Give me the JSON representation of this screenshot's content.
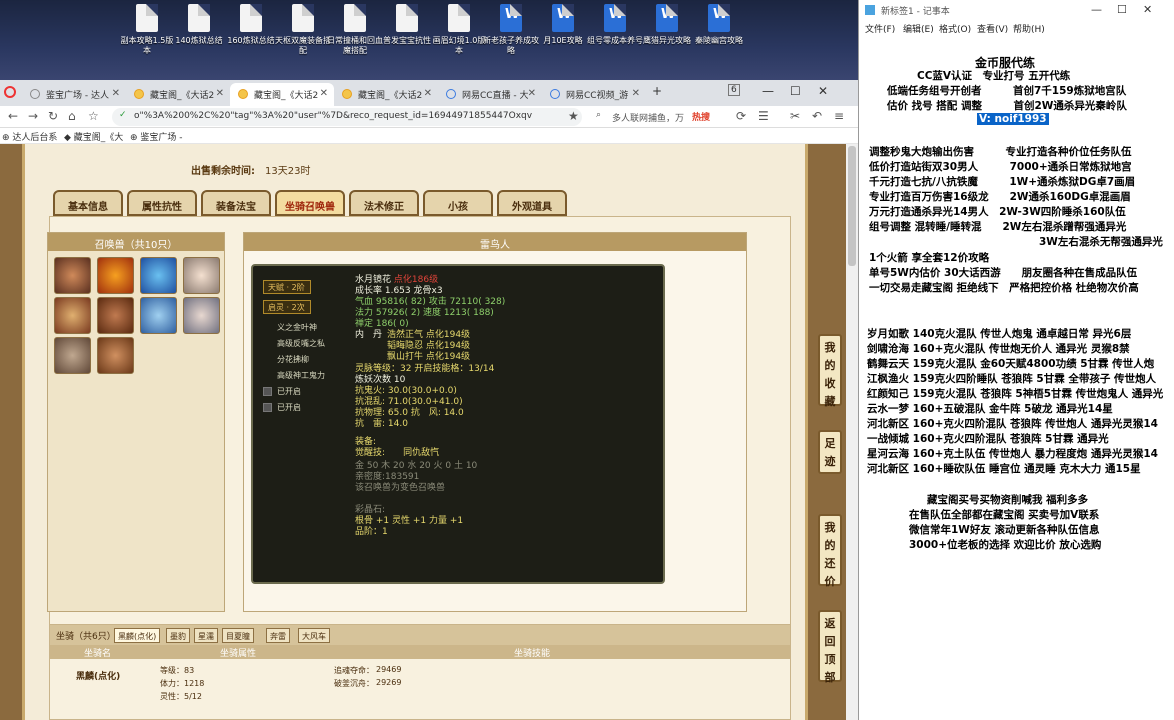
{
  "desktop": {
    "icons": [
      {
        "label": "副本攻略1.5版本",
        "type": "doc"
      },
      {
        "label": "140炼狱总结",
        "type": "doc"
      },
      {
        "label": "160炼狱总结",
        "type": "doc"
      },
      {
        "label": "天枢双魔装备搭配",
        "type": "doc"
      },
      {
        "label": "日常撞桶和回血魔搭配",
        "type": "doc"
      },
      {
        "label": "普发宝宝抗性",
        "type": "doc"
      },
      {
        "label": "画眉幻境1.0版本",
        "type": "doc"
      },
      {
        "label": "新老孩子养成攻略",
        "type": "word"
      },
      {
        "label": "月10E攻略",
        "type": "word"
      },
      {
        "label": "组号零成本养号",
        "type": "word"
      },
      {
        "label": "鹰猎异光攻略",
        "type": "word"
      },
      {
        "label": "秦陵幽宫攻略",
        "type": "word"
      }
    ]
  },
  "browser": {
    "tabs": [
      {
        "label": "鉴宝广场 - 达人"
      },
      {
        "label": "藏宝阁_《大话2"
      },
      {
        "label": "藏宝阁_《大话2",
        "active": true
      },
      {
        "label": "藏宝阁_《大话2"
      },
      {
        "label": "网易CC直播 - 大"
      },
      {
        "label": "网易CC视频_游"
      }
    ],
    "tab_count": "6",
    "url": "o\"%3A%200%2C%20\"tag\"%3A%20\"user\"%7D&reco_request_id=16944971855447Oxqv",
    "search_placeholder": "多人联网捕鱼，万",
    "hot_badge": "热搜",
    "bookmarks": [
      "达人后台系",
      "藏宝阁_《大",
      "鉴宝广场 -"
    ]
  },
  "page": {
    "sale_time_label": "出售剩余时间:",
    "sale_time_value": "13天23时",
    "tabs": [
      "基本信息",
      "属性抗性",
      "装备法宝",
      "坐骑召唤兽",
      "法术修正",
      "小孩",
      "外观道具"
    ],
    "summon_header": "召唤兽（共10只）",
    "name_header": "雷鸟人",
    "tooltip": {
      "talent_pill": "天赋 · 2阶",
      "awaken_pill": "启灵 · 2次",
      "skills": [
        "义之金叶神",
        "高级反嘴之私",
        "分花拂柳",
        "高级神工鬼力"
      ],
      "opened": [
        "已开启",
        "已开启"
      ],
      "name": "水月镜花",
      "name_tag": "点化186级",
      "growth": "成长率 1.653",
      "dragon_bone": "龙骨x3",
      "qixue": "气血 95816( 82)",
      "attack": "攻击 72110( 328)",
      "fali": "法力 57926( 2)",
      "speed": "速度 1213( 188)",
      "zen": "禅定 186( 0)",
      "neidan_label": "内　丹",
      "neidan": [
        "浩然正气 点化194级",
        "韬晦隐忍 点化194级",
        "飘山打牛 点化194级"
      ],
      "ling_label": "灵脉等级：",
      "ling_value": "32",
      "ling_skill": "开启技能格：",
      "ling_skill_value": "13/14",
      "refine": "炼妖次数 10",
      "kanggui": "抗鬼火: 30.0(30.0+0.0)",
      "kanghun": "抗混乱: 71.0(30.0+41.0)",
      "kangwuli": "抗物理: 65.0",
      "kangfeng": "抗　风: 14.0",
      "kanglei": "抗　雷: 14.0",
      "equip_label": "装备:",
      "awaken_skill_label": "觉醒技:",
      "awaken_skill": "同仇敌忾",
      "elements": "金 50  木 20  水 20  火 0  土 10",
      "intimacy": "亲密度:183591",
      "changecolor": "该召唤兽为变色召唤兽",
      "gem_label": "彩晶石:",
      "gem": "根骨 +1  灵性 +1  力量 +1",
      "gem_grade": "品阶：1"
    },
    "mount": {
      "label": "坐骑（共6只）",
      "tabs": [
        "黑麟(点化)",
        "墨豹",
        "星濡",
        "目夏瞳",
        "奔雷",
        "大风车"
      ],
      "col_mount": "坐骑名",
      "col_attr": "坐骑属性",
      "col_skill": "坐骑技能",
      "name": "黑麟(点化)",
      "level": "等级：83",
      "tili": "体力：1218",
      "lingxing": "灵性：5/12",
      "skill1": "追魂夺命：",
      "skill1_val": "29469",
      "skill2": "破釜沉舟：",
      "skill2_val": "29269"
    },
    "side_buttons": [
      "我的收藏",
      "足迹",
      "我的还价",
      "返回顶部"
    ]
  },
  "notepad": {
    "title": "新标签1 - 记事本",
    "menu": [
      "文件(F)",
      "编辑(E)",
      "格式(O)",
      "查看(V)",
      "帮助(H)"
    ],
    "lines": [
      "金币服代练",
      "CC蓝V认证　专业打号 五开代练",
      "低端任务组号开创者　　　首创7千159炼狱地宫队",
      "估价 找号 搭配 调整　　　首创2W通杀异光秦岭队",
      "V:  noif1993",
      "调整秒鬼大炮输出伤害　　　专业打造各种价位任务队伍",
      "低价打造站街双30男人　　　7000+通杀日常炼狱地宫",
      "千元打造七抗/八抗铁魔　　　1W+通杀炼狱DG卓7画眉",
      "专业打造百万伤害16级龙　　2W通杀160DG卓混画眉",
      "万元打造通杀异光14男人　2W-3W四阶睡杀160队伍",
      "组号调整 混转睡/睡转混　　2W左右混杀蹭帮强通异光",
      "3W左右混杀无帮强通异光",
      "1个火箭 享全套12价攻略",
      "单号5W内估价 30大话西游　　朋友圈各种在售成品队伍",
      "一切交易走藏宝阁 拒绝线下　严格把控价格 杜绝物次价高",
      "岁月如歌 140克火混队 传世人炮鬼 通卓越日常 异光6层",
      "剑啸沧海 160+克火混队 传世炮无价人 通异光 灵猴8禁",
      "鹤舞云天 159克火混队 金60天赋4800功绩 5甘霖 传世人炮",
      "江枫渔火 159克火四阶睡队 苍狼阵 5甘霖 全带孩子 传世炮人",
      "红颜知己 159克火混队 苍狼阵 5神梧5甘霖 传世炮鬼人 通异光",
      "云水一梦 160+五破混队 金牛阵 5破龙 通异光14星",
      "河北新区 160+克火四阶混队 苍狼阵 传世炮人 通异光灵猴14",
      "一战倾城 160+克火四阶混队 苍狼阵 5甘霖 通异光",
      "星河云海 160+克土队伍 传世炮人 暴力程度炮 通异光灵猴14",
      "河北新区 160+睡砍队伍 睡宫位 通灵睡 克木大力 通15星",
      "藏宝阁买号买物资削喊我 福利多多",
      "在售队伍全部都在藏宝阁 买卖号加V联系",
      "微信常年1W好友 滚动更新各种队伍信息",
      "3000+位老板的选择 欢迎比价 放心选购"
    ]
  }
}
